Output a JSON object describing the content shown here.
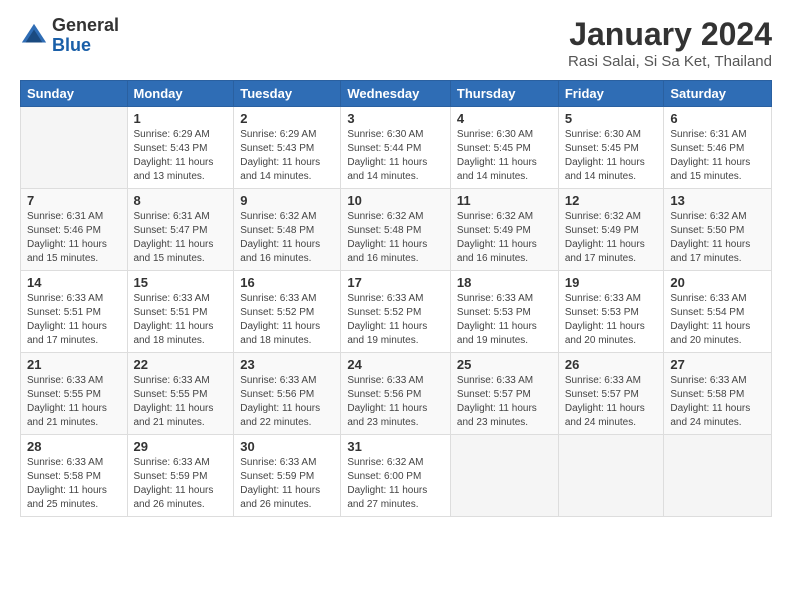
{
  "logo": {
    "general": "General",
    "blue": "Blue"
  },
  "title": "January 2024",
  "subtitle": "Rasi Salai, Si Sa Ket, Thailand",
  "header_days": [
    "Sunday",
    "Monday",
    "Tuesday",
    "Wednesday",
    "Thursday",
    "Friday",
    "Saturday"
  ],
  "weeks": [
    [
      {
        "day": "",
        "info": ""
      },
      {
        "day": "1",
        "info": "Sunrise: 6:29 AM\nSunset: 5:43 PM\nDaylight: 11 hours\nand 13 minutes."
      },
      {
        "day": "2",
        "info": "Sunrise: 6:29 AM\nSunset: 5:43 PM\nDaylight: 11 hours\nand 14 minutes."
      },
      {
        "day": "3",
        "info": "Sunrise: 6:30 AM\nSunset: 5:44 PM\nDaylight: 11 hours\nand 14 minutes."
      },
      {
        "day": "4",
        "info": "Sunrise: 6:30 AM\nSunset: 5:45 PM\nDaylight: 11 hours\nand 14 minutes."
      },
      {
        "day": "5",
        "info": "Sunrise: 6:30 AM\nSunset: 5:45 PM\nDaylight: 11 hours\nand 14 minutes."
      },
      {
        "day": "6",
        "info": "Sunrise: 6:31 AM\nSunset: 5:46 PM\nDaylight: 11 hours\nand 15 minutes."
      }
    ],
    [
      {
        "day": "7",
        "info": "Sunrise: 6:31 AM\nSunset: 5:46 PM\nDaylight: 11 hours\nand 15 minutes."
      },
      {
        "day": "8",
        "info": "Sunrise: 6:31 AM\nSunset: 5:47 PM\nDaylight: 11 hours\nand 15 minutes."
      },
      {
        "day": "9",
        "info": "Sunrise: 6:32 AM\nSunset: 5:48 PM\nDaylight: 11 hours\nand 16 minutes."
      },
      {
        "day": "10",
        "info": "Sunrise: 6:32 AM\nSunset: 5:48 PM\nDaylight: 11 hours\nand 16 minutes."
      },
      {
        "day": "11",
        "info": "Sunrise: 6:32 AM\nSunset: 5:49 PM\nDaylight: 11 hours\nand 16 minutes."
      },
      {
        "day": "12",
        "info": "Sunrise: 6:32 AM\nSunset: 5:49 PM\nDaylight: 11 hours\nand 17 minutes."
      },
      {
        "day": "13",
        "info": "Sunrise: 6:32 AM\nSunset: 5:50 PM\nDaylight: 11 hours\nand 17 minutes."
      }
    ],
    [
      {
        "day": "14",
        "info": "Sunrise: 6:33 AM\nSunset: 5:51 PM\nDaylight: 11 hours\nand 17 minutes."
      },
      {
        "day": "15",
        "info": "Sunrise: 6:33 AM\nSunset: 5:51 PM\nDaylight: 11 hours\nand 18 minutes."
      },
      {
        "day": "16",
        "info": "Sunrise: 6:33 AM\nSunset: 5:52 PM\nDaylight: 11 hours\nand 18 minutes."
      },
      {
        "day": "17",
        "info": "Sunrise: 6:33 AM\nSunset: 5:52 PM\nDaylight: 11 hours\nand 19 minutes."
      },
      {
        "day": "18",
        "info": "Sunrise: 6:33 AM\nSunset: 5:53 PM\nDaylight: 11 hours\nand 19 minutes."
      },
      {
        "day": "19",
        "info": "Sunrise: 6:33 AM\nSunset: 5:53 PM\nDaylight: 11 hours\nand 20 minutes."
      },
      {
        "day": "20",
        "info": "Sunrise: 6:33 AM\nSunset: 5:54 PM\nDaylight: 11 hours\nand 20 minutes."
      }
    ],
    [
      {
        "day": "21",
        "info": "Sunrise: 6:33 AM\nSunset: 5:55 PM\nDaylight: 11 hours\nand 21 minutes."
      },
      {
        "day": "22",
        "info": "Sunrise: 6:33 AM\nSunset: 5:55 PM\nDaylight: 11 hours\nand 21 minutes."
      },
      {
        "day": "23",
        "info": "Sunrise: 6:33 AM\nSunset: 5:56 PM\nDaylight: 11 hours\nand 22 minutes."
      },
      {
        "day": "24",
        "info": "Sunrise: 6:33 AM\nSunset: 5:56 PM\nDaylight: 11 hours\nand 23 minutes."
      },
      {
        "day": "25",
        "info": "Sunrise: 6:33 AM\nSunset: 5:57 PM\nDaylight: 11 hours\nand 23 minutes."
      },
      {
        "day": "26",
        "info": "Sunrise: 6:33 AM\nSunset: 5:57 PM\nDaylight: 11 hours\nand 24 minutes."
      },
      {
        "day": "27",
        "info": "Sunrise: 6:33 AM\nSunset: 5:58 PM\nDaylight: 11 hours\nand 24 minutes."
      }
    ],
    [
      {
        "day": "28",
        "info": "Sunrise: 6:33 AM\nSunset: 5:58 PM\nDaylight: 11 hours\nand 25 minutes."
      },
      {
        "day": "29",
        "info": "Sunrise: 6:33 AM\nSunset: 5:59 PM\nDaylight: 11 hours\nand 26 minutes."
      },
      {
        "day": "30",
        "info": "Sunrise: 6:33 AM\nSunset: 5:59 PM\nDaylight: 11 hours\nand 26 minutes."
      },
      {
        "day": "31",
        "info": "Sunrise: 6:32 AM\nSunset: 6:00 PM\nDaylight: 11 hours\nand 27 minutes."
      },
      {
        "day": "",
        "info": ""
      },
      {
        "day": "",
        "info": ""
      },
      {
        "day": "",
        "info": ""
      }
    ]
  ]
}
